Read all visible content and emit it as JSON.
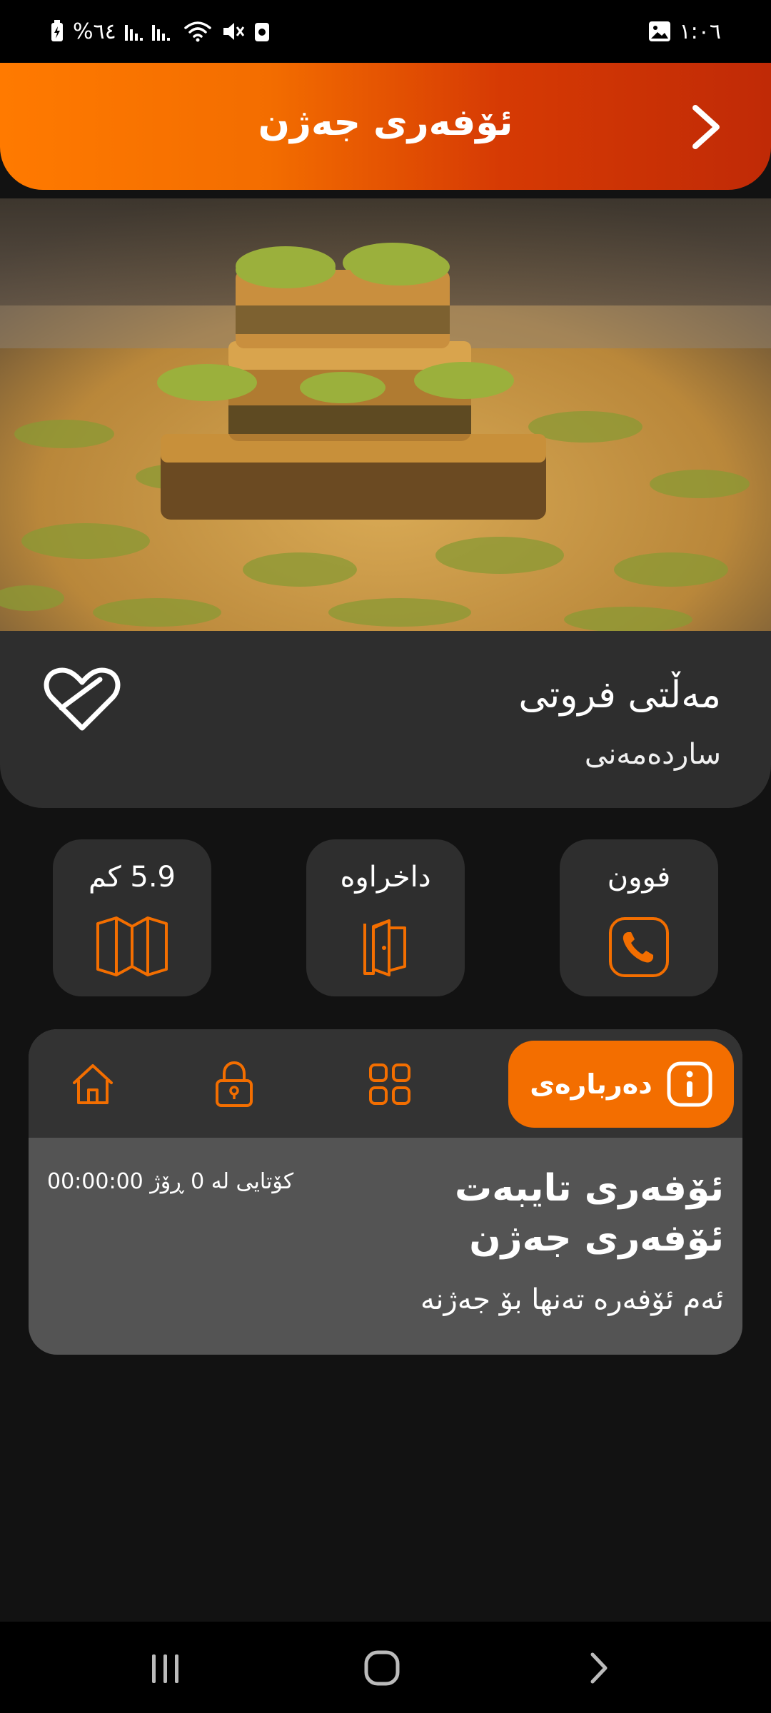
{
  "status_bar": {
    "battery": "%٦٤",
    "time": "١:٠٦"
  },
  "header": {
    "title": "ئۆفەری جەژن"
  },
  "place": {
    "name": "مەڵتی فروتی",
    "type": "ساردەمەنی"
  },
  "actions": {
    "phone_label": "فوون",
    "closed_label": "داخراوە",
    "distance_label": "5.9 کم"
  },
  "tabs": {
    "about_label": "دەربارەی"
  },
  "offer": {
    "title_line1": "ئۆفەری تایبەت",
    "title_line2": "ئۆفەری جەژن",
    "description": "ئەم ئۆفەرە تەنها بۆ جەژنە",
    "countdown": "کۆتایی لە 0 ڕۆژ 00:00:00"
  },
  "colors": {
    "accent": "#f36e00",
    "header_gradient_end": "#c02a06",
    "background": "#121212",
    "card": "#2e2e2e"
  },
  "icons": [
    "battery-icon",
    "signal-icon",
    "wifi-icon",
    "mute-icon",
    "gallery-icon",
    "back-chevron-icon",
    "heart-icon",
    "phone-icon",
    "door-icon",
    "map-icon",
    "info-icon",
    "grid-icon",
    "lock-icon",
    "home-icon"
  ]
}
